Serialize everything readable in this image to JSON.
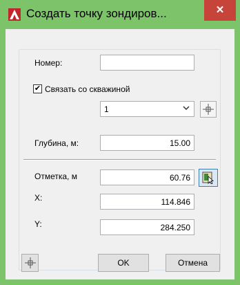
{
  "window": {
    "title": "Создать точку зондиров...",
    "close_label": "✕",
    "accent": "#7cc36a",
    "close_color": "#c7443a"
  },
  "form": {
    "number_label": "Номер:",
    "number_value": "",
    "link_checkbox_label": "Связать со скважиной",
    "link_checked": true,
    "borehole_selected": "1",
    "depth_label": "Глубина, м:",
    "depth_value": "15.00",
    "elevation_label": "Отметка, м",
    "elevation_value": "60.76",
    "x_label": "X:",
    "x_value": "114.846",
    "y_label": "Y:",
    "y_value": "284.250"
  },
  "buttons": {
    "ok": "OK",
    "cancel": "Отмена"
  },
  "icons": {
    "app": "autocad-icon",
    "pick_point": "pick-point-icon",
    "select_object": "select-object-icon",
    "dropdown": "chevron-down-icon"
  }
}
